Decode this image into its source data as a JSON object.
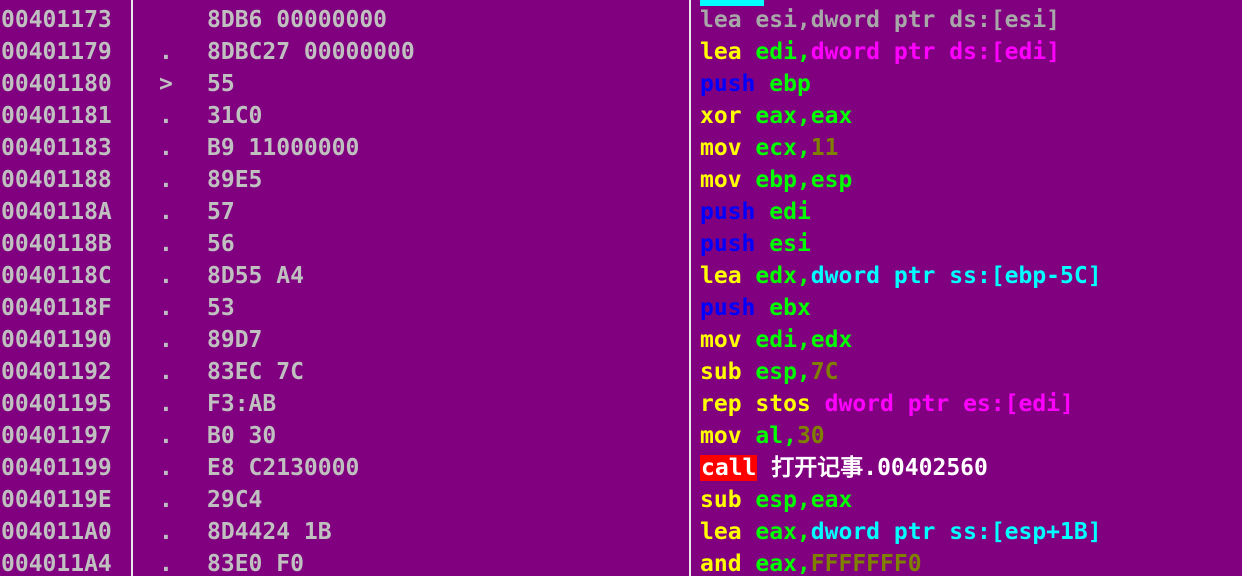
{
  "colors": {
    "background": "#800080",
    "separator": "#e8e8e8",
    "eip_marker": "#00ffff",
    "address": "#c0c0c0",
    "hex": "#c0c0c0",
    "grey": "#a8a8a8",
    "mnemonic": "#ffff00",
    "push": "#0000ff",
    "register": "#00ff00",
    "memory": "#ff00ff",
    "stackmem": "#00ffff",
    "imm": "#808000",
    "text": "#ffffff",
    "call_bg": "#ff0000"
  },
  "rows": [
    {
      "addr": "00401173",
      "flag": "",
      "hex": "8DB6 00000000",
      "tokens": [
        {
          "t": "lea esi,dword ptr ds:[esi]",
          "c": "grey"
        }
      ]
    },
    {
      "addr": "00401179",
      "flag": ".",
      "hex": "8DBC27 00000000",
      "tokens": [
        {
          "t": "lea ",
          "c": "mnemonic"
        },
        {
          "t": "edi",
          "c": "register"
        },
        {
          "t": ",",
          "c": "register"
        },
        {
          "t": "dword ptr ds:[edi]",
          "c": "memory"
        }
      ]
    },
    {
      "addr": "00401180",
      "flag": ">",
      "hex": "55",
      "tokens": [
        {
          "t": "push ",
          "c": "push"
        },
        {
          "t": "ebp",
          "c": "register"
        }
      ]
    },
    {
      "addr": "00401181",
      "flag": ".",
      "hex": "31C0",
      "tokens": [
        {
          "t": "xor ",
          "c": "mnemonic"
        },
        {
          "t": "eax,eax",
          "c": "register"
        }
      ]
    },
    {
      "addr": "00401183",
      "flag": ".",
      "hex": "B9 11000000",
      "tokens": [
        {
          "t": "mov ",
          "c": "mnemonic"
        },
        {
          "t": "ecx,",
          "c": "register"
        },
        {
          "t": "11",
          "c": "imm"
        }
      ]
    },
    {
      "addr": "00401188",
      "flag": ".",
      "hex": "89E5",
      "tokens": [
        {
          "t": "mov ",
          "c": "mnemonic"
        },
        {
          "t": "ebp,esp",
          "c": "register"
        }
      ]
    },
    {
      "addr": "0040118A",
      "flag": ".",
      "hex": "57",
      "tokens": [
        {
          "t": "push ",
          "c": "push"
        },
        {
          "t": "edi",
          "c": "register"
        }
      ]
    },
    {
      "addr": "0040118B",
      "flag": ".",
      "hex": "56",
      "tokens": [
        {
          "t": "push ",
          "c": "push"
        },
        {
          "t": "esi",
          "c": "register"
        }
      ]
    },
    {
      "addr": "0040118C",
      "flag": ".",
      "hex": "8D55 A4",
      "tokens": [
        {
          "t": "lea ",
          "c": "mnemonic"
        },
        {
          "t": "edx,",
          "c": "register"
        },
        {
          "t": "dword ptr ss:[ebp-5C]",
          "c": "stackmem"
        }
      ]
    },
    {
      "addr": "0040118F",
      "flag": ".",
      "hex": "53",
      "tokens": [
        {
          "t": "push ",
          "c": "push"
        },
        {
          "t": "ebx",
          "c": "register"
        }
      ]
    },
    {
      "addr": "00401190",
      "flag": ".",
      "hex": "89D7",
      "tokens": [
        {
          "t": "mov ",
          "c": "mnemonic"
        },
        {
          "t": "edi,edx",
          "c": "register"
        }
      ]
    },
    {
      "addr": "00401192",
      "flag": ".",
      "hex": "83EC 7C",
      "tokens": [
        {
          "t": "sub ",
          "c": "mnemonic"
        },
        {
          "t": "esp,",
          "c": "register"
        },
        {
          "t": "7C",
          "c": "imm"
        }
      ]
    },
    {
      "addr": "00401195",
      "flag": ".",
      "hex": "F3:AB",
      "tokens": [
        {
          "t": "rep stos ",
          "c": "mnemonic"
        },
        {
          "t": "dword ptr es:[edi]",
          "c": "memory"
        }
      ]
    },
    {
      "addr": "00401197",
      "flag": ".",
      "hex": "B0 30",
      "tokens": [
        {
          "t": "mov ",
          "c": "mnemonic"
        },
        {
          "t": "al,",
          "c": "register"
        },
        {
          "t": "30",
          "c": "imm"
        }
      ]
    },
    {
      "addr": "00401199",
      "flag": ".",
      "hex": "E8 C2130000",
      "tokens": [
        {
          "t": "call",
          "c": "mnemonic",
          "hl": true
        },
        {
          "t": " 打开记事.00402560",
          "c": "text"
        }
      ]
    },
    {
      "addr": "0040119E",
      "flag": ".",
      "hex": "29C4",
      "tokens": [
        {
          "t": "sub ",
          "c": "mnemonic"
        },
        {
          "t": "esp,eax",
          "c": "register"
        }
      ]
    },
    {
      "addr": "004011A0",
      "flag": ".",
      "hex": "8D4424 1B",
      "tokens": [
        {
          "t": "lea ",
          "c": "mnemonic"
        },
        {
          "t": "eax,",
          "c": "register"
        },
        {
          "t": "dword ptr ss:[esp+1B]",
          "c": "stackmem"
        }
      ]
    },
    {
      "addr": "004011A4",
      "flag": ".",
      "hex": "83E0 F0",
      "tokens": [
        {
          "t": "and ",
          "c": "mnemonic"
        },
        {
          "t": "eax,",
          "c": "register"
        },
        {
          "t": "FFFFFFF0",
          "c": "imm"
        }
      ]
    }
  ]
}
